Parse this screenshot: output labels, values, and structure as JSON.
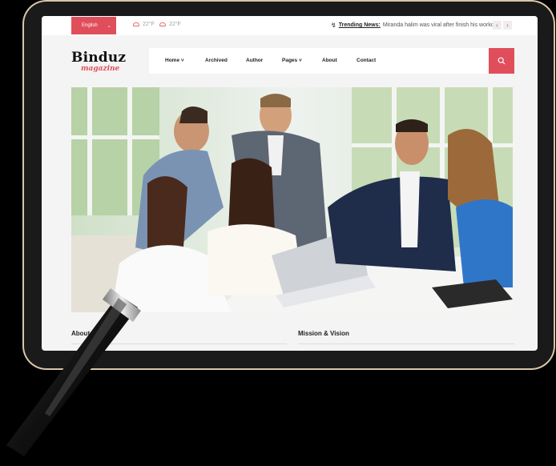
{
  "topbar": {
    "language": "English",
    "weather": [
      {
        "icon": "cloud-icon",
        "temp": "22°F"
      },
      {
        "icon": "cloud-icon",
        "temp": "22°F"
      }
    ],
    "trending_label": "Trending News:",
    "trending_text": "Miranda halim was viral after finish his workout.",
    "prev": "‹",
    "next": "›"
  },
  "brand": {
    "name": "Binduz",
    "tagline": "magazine"
  },
  "nav": {
    "items": [
      {
        "label": "Home",
        "dropdown": true
      },
      {
        "label": "Archived",
        "dropdown": false
      },
      {
        "label": "Author",
        "dropdown": false
      },
      {
        "label": "Pages",
        "dropdown": true
      },
      {
        "label": "About",
        "dropdown": false
      },
      {
        "label": "Contact",
        "dropdown": false
      }
    ],
    "search_icon": "search-icon"
  },
  "sections": {
    "about": "About",
    "mission": "Mission & Vision"
  },
  "colors": {
    "accent": "#e04e5b",
    "frame": "#d8c6a8",
    "background": "#000000"
  }
}
